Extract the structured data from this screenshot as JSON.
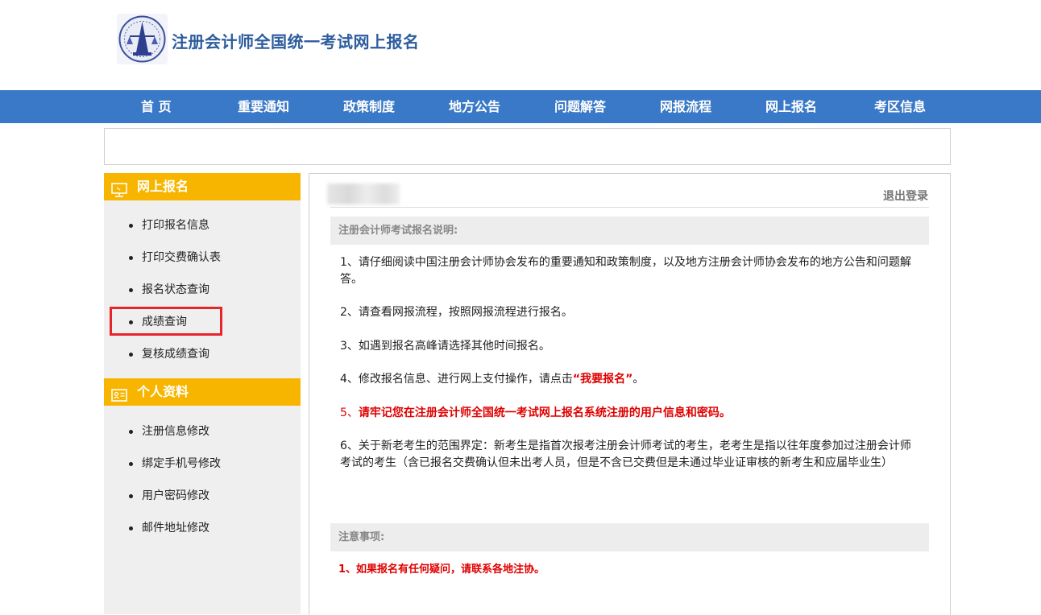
{
  "header": {
    "logo_icon": "cicpa-emblem-icon",
    "site_title": "注册会计师全国统一考试网上报名"
  },
  "nav": {
    "items": [
      "首 页",
      "重要通知",
      "政策制度",
      "地方公告",
      "问题解答",
      "网报流程",
      "网上报名",
      "考区信息"
    ]
  },
  "sidebar": {
    "section1": {
      "icon": "monitor-icon",
      "title": "网上报名",
      "items": [
        "打印报名信息",
        "打印交费确认表",
        "报名状态查询",
        "成绩查询",
        "复核成绩查询"
      ]
    },
    "section2": {
      "icon": "id-card-icon",
      "title": "个人资料",
      "items": [
        "注册信息修改",
        "绑定手机号修改",
        "用户密码修改",
        "邮件地址修改"
      ]
    }
  },
  "main": {
    "logout": "退出登录",
    "notice_header": "注册会计师考试报名说明:",
    "p1": "1、请仔细阅读中国注册会计师协会发布的重要通知和政策制度，以及地方注册会计师协会发布的地方公告和问题解答。",
    "p2": "2、请查看网报流程，按照网报流程进行报名。",
    "p3": "3、如遇到报名高峰请选择其他时间报名。",
    "p4_prefix": "4、修改报名信息、进行网上支付操作，请点击",
    "p4_link": "“我要报名”",
    "p4_suffix": "。",
    "p5_prefix": "5、",
    "p5_red": "请牢记您在注册会计师全国统一考试网上报名系统注册的用户信息和密码。",
    "p6": "6、关于新老考生的范围界定：新考生是指首次报考注册会计师考试的考生，老考生是指以往年度参加过注册会计师考试的考生（含已报名交费确认但未出考人员，但是不含已交费但是未通过毕业证审核的新考生和应届毕业生）",
    "attention_header": "注意事项:",
    "attention1": "1、如果报名有任何疑问，请联系各地注协。"
  },
  "colors": {
    "nav_bg": "#3a79c7",
    "sidebar_header": "#f8b500",
    "title_blue": "#2d5d9d",
    "highlight_red": "#e8242b"
  }
}
